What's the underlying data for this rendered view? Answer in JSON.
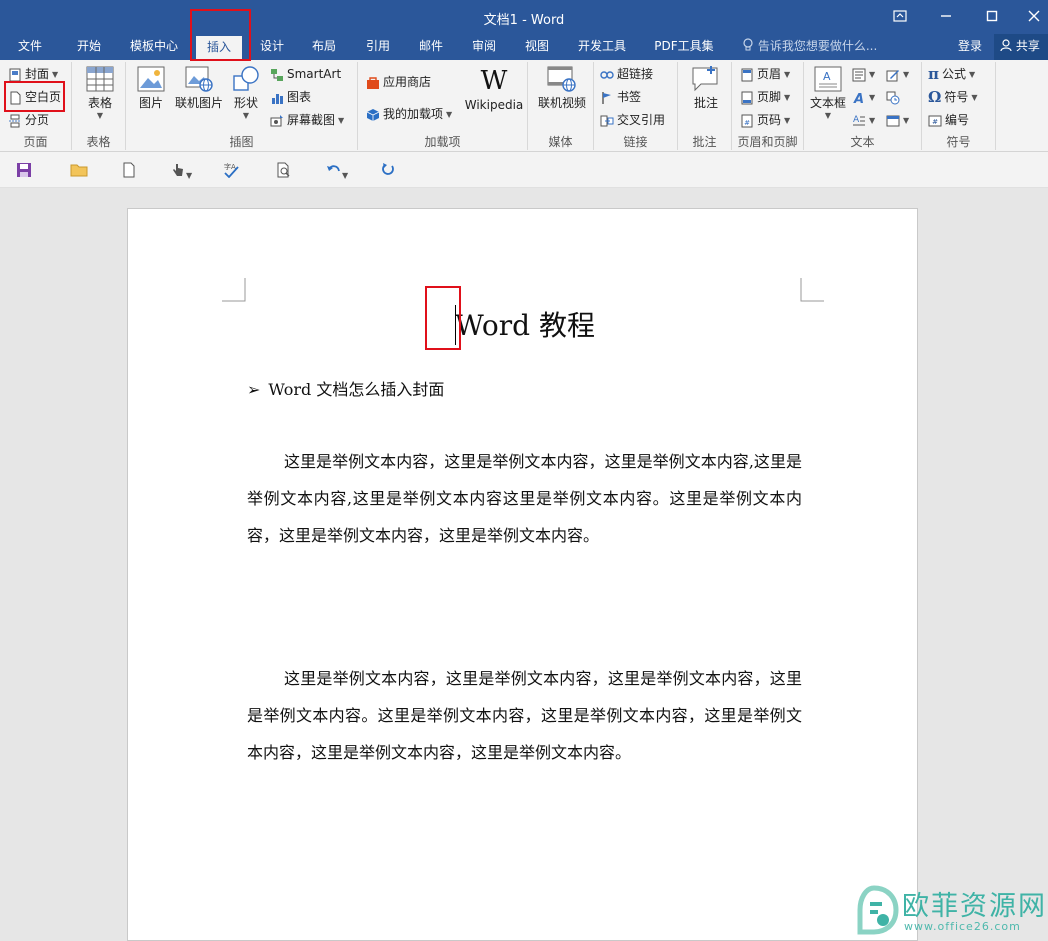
{
  "window": {
    "title": "文档1 - Word"
  },
  "tabs": [
    {
      "label": "文件"
    },
    {
      "label": "开始"
    },
    {
      "label": "模板中心"
    },
    {
      "label": "插入"
    },
    {
      "label": "设计"
    },
    {
      "label": "布局"
    },
    {
      "label": "引用"
    },
    {
      "label": "邮件"
    },
    {
      "label": "审阅"
    },
    {
      "label": "视图"
    },
    {
      "label": "开发工具"
    },
    {
      "label": "PDF工具集"
    }
  ],
  "active_tab": "插入",
  "tell_me": "告诉我您想要做什么...",
  "login": "登录",
  "share": "共享",
  "ribbon": {
    "pages": {
      "label": "页面",
      "cover": "封面",
      "blank_page": "空白页",
      "page_break": "分页"
    },
    "tables": {
      "label": "表格",
      "table": "表格"
    },
    "illustrations": {
      "label": "插图",
      "picture": "图片",
      "online_picture": "联机图片",
      "shapes": "形状",
      "smartart": "SmartArt",
      "chart": "图表",
      "screenshot": "屏幕截图"
    },
    "addins": {
      "label": "加载项",
      "store": "应用商店",
      "my_addins": "我的加载项",
      "wikipedia": "Wikipedia"
    },
    "media": {
      "label": "媒体",
      "online_video": "联机视频"
    },
    "links": {
      "label": "链接",
      "hyperlink": "超链接",
      "bookmark": "书签",
      "cross_ref": "交叉引用"
    },
    "comments": {
      "label": "批注",
      "comment": "批注"
    },
    "header_footer": {
      "label": "页眉和页脚",
      "header": "页眉",
      "footer": "页脚",
      "page_number": "页码"
    },
    "text": {
      "label": "文本",
      "textbox": "文本框"
    },
    "symbols": {
      "label": "符号",
      "equation": "公式",
      "symbol": "符号",
      "numbering": "编号"
    }
  },
  "document": {
    "title": "Word 教程",
    "bullet": "Word 文档怎么插入封面",
    "para1": "这里是举例文本内容，这里是举例文本内容，这里是举例文本内容,这里是举例文本内容,这里是举例文本内容这里是举例文本内容。这里是举例文本内容，这里是举例文本内容，这里是举例文本内容。",
    "para2": "这里是举例文本内容，这里是举例文本内容，这里是举例文本内容，这里是举例文本内容。这里是举例文本内容，这里是举例文本内容，这里是举例文本内容，这里是举例文本内容，这里是举例文本内容。"
  },
  "watermark": {
    "name": "欧菲资源网",
    "url": "www.office26.com"
  },
  "colors": {
    "brand": "#2b579a",
    "highlight": "#e0101a",
    "watermark": "#3fb3a6"
  }
}
